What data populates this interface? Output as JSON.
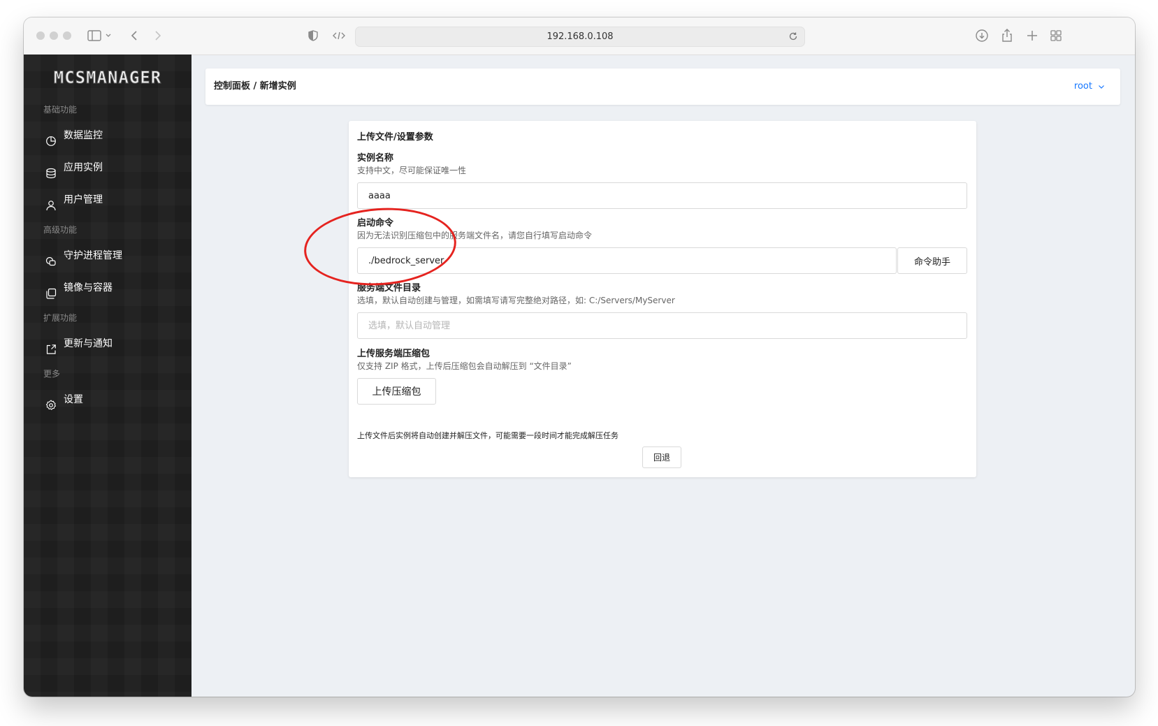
{
  "browser": {
    "url": "192.168.0.108"
  },
  "sidebar": {
    "logo": "MCSMANAGER",
    "groups": {
      "basic": "基础功能",
      "advanced": "高级功能",
      "extend": "扩展功能",
      "more": "更多"
    },
    "items": [
      {
        "label": "数据监控",
        "icon": "chart-pie-icon"
      },
      {
        "label": "应用实例",
        "icon": "database-icon"
      },
      {
        "label": "用户管理",
        "icon": "user-icon"
      },
      {
        "label": "守护进程管理",
        "icon": "daemon-icon"
      },
      {
        "label": "镜像与容器",
        "icon": "copy-icon"
      },
      {
        "label": "更新与通知",
        "icon": "external-link-icon"
      },
      {
        "label": "设置",
        "icon": "gear-icon"
      }
    ]
  },
  "header": {
    "breadcrumb": "控制面板 / 新增实例",
    "user": "root"
  },
  "form": {
    "title": "上传文件/设置参数",
    "name": {
      "label": "实例名称",
      "desc": "支持中文，尽可能保证唯一性",
      "value": "aaaa"
    },
    "command": {
      "label": "启动命令",
      "desc": "因为无法识别压缩包中的服务端文件名，请您自行填写启动命令",
      "value": "./bedrock_server",
      "helper_button": "命令助手"
    },
    "dir": {
      "label": "服务端文件目录",
      "desc": "选填，默认自动创建与管理，如需填写请写完整绝对路径，如: C:/Servers/MyServer",
      "placeholder": "选填，默认自动管理"
    },
    "upload": {
      "label": "上传服务端压缩包",
      "desc": "仅支持 ZIP 格式，上传后压缩包会自动解压到 “文件目录”",
      "button": "上传压缩包"
    },
    "note": "上传文件后实例将自动创建并解压文件，可能需要一段时间才能完成解压任务",
    "back_button": "回退"
  },
  "colors": {
    "accent": "#1677ff",
    "sidebar_bg": "#222222",
    "annotation": "#e5231f"
  }
}
